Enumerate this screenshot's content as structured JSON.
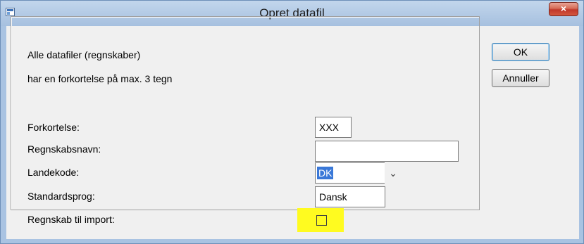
{
  "window": {
    "title": "Opret datafil",
    "close_label": "×"
  },
  "info": {
    "line1": "Alle datafiler (regnskaber)",
    "line2": "har en forkortelse på max. 3 tegn"
  },
  "form": {
    "forkortelse": {
      "label": "Forkortelse:",
      "value": "XXX"
    },
    "regnskabsnavn": {
      "label": "Regnskabsnavn:",
      "value": ""
    },
    "landekode": {
      "label": "Landekode:",
      "value": "DK",
      "arrow": "⌄"
    },
    "standardsprog": {
      "label": "Standardsprog:",
      "value": "Dansk"
    },
    "import": {
      "label": "Regnskab til import:",
      "checked": false
    }
  },
  "buttons": {
    "ok_label": "OK",
    "cancel_label": "Annuller"
  },
  "colors": {
    "highlight": "#fffb20",
    "selection": "#3a78d8",
    "close_button": "#c0382a"
  }
}
